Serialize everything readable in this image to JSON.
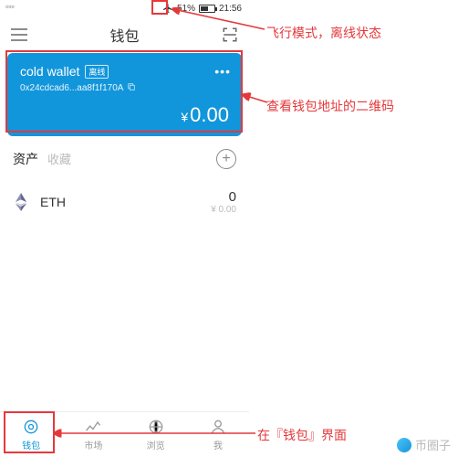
{
  "statusbar": {
    "carrier_glyphs": "▫▫▫",
    "battery_percent": "51%",
    "time": "21:56"
  },
  "header": {
    "title": "钱包"
  },
  "wallet_card": {
    "name": "cold wallet",
    "badge": "离线",
    "address": "0x24cdcad6...aa8f1f170A",
    "currency_symbol": "¥",
    "balance": "0.00",
    "accent": "#1296db"
  },
  "assets": {
    "tab_assets": "资产",
    "tab_collectibles": "收藏",
    "items": [
      {
        "symbol": "ETH",
        "amount": "0",
        "fiat": "¥ 0.00"
      }
    ]
  },
  "tabbar": {
    "items": [
      {
        "label": "钱包",
        "active": true
      },
      {
        "label": "市场",
        "active": false
      },
      {
        "label": "浏览",
        "active": false
      },
      {
        "label": "我",
        "active": false
      }
    ]
  },
  "annotations": {
    "airplane": "飞行模式，离线状态",
    "qr": "查看钱包地址的二维码",
    "wallet_tab": "在『钱包』界面"
  },
  "watermark": {
    "text": "币圈子"
  }
}
